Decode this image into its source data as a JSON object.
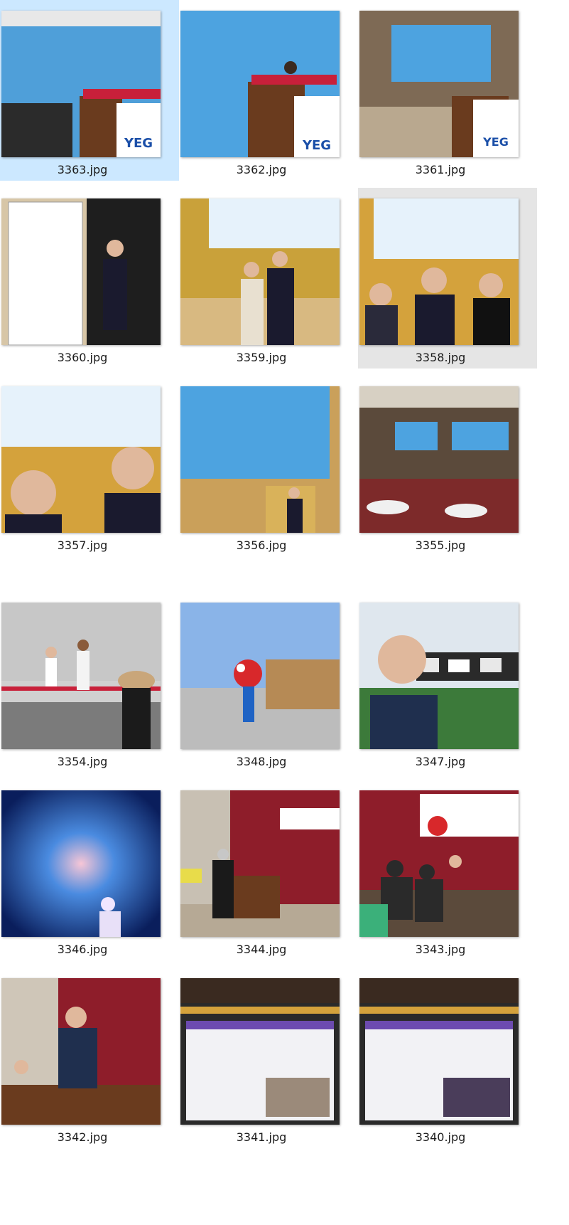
{
  "files": [
    {
      "name": "3363.jpg",
      "state": "selected",
      "scene": "ceremony-yeg"
    },
    {
      "name": "3362.jpg",
      "state": "normal",
      "scene": "speech-governor"
    },
    {
      "name": "3361.jpg",
      "state": "normal",
      "scene": "stage-wide"
    },
    {
      "name": "3360.jpg",
      "state": "normal",
      "scene": "signboard"
    },
    {
      "name": "3359.jpg",
      "state": "normal",
      "scene": "party-pair"
    },
    {
      "name": "3358.jpg",
      "state": "hover",
      "scene": "party-trio"
    },
    {
      "name": "3357.jpg",
      "state": "normal",
      "scene": "selfie-two"
    },
    {
      "name": "3356.jpg",
      "state": "normal",
      "scene": "screen-speaker"
    },
    {
      "name": "3355.jpg",
      "state": "normal",
      "scene": "banquet-hall"
    },
    {
      "name": "3354.jpg",
      "state": "normal",
      "scene": "street-performance"
    },
    {
      "name": "3348.jpg",
      "state": "normal",
      "scene": "expo-mascot"
    },
    {
      "name": "3347.jpg",
      "state": "normal",
      "scene": "expo-selfie"
    },
    {
      "name": "3346.jpg",
      "state": "normal",
      "scene": "galaxy-show"
    },
    {
      "name": "3344.jpg",
      "state": "normal",
      "scene": "assembly-podium"
    },
    {
      "name": "3343.jpg",
      "state": "normal",
      "scene": "assembly-audience"
    },
    {
      "name": "3342.jpg",
      "state": "normal",
      "scene": "assembly-speaker"
    },
    {
      "name": "3341.jpg",
      "state": "normal",
      "scene": "lecture-slide"
    },
    {
      "name": "3340.jpg",
      "state": "normal",
      "scene": "lecture-slide-2"
    }
  ],
  "colors": {
    "selected_bg": "#cce8ff",
    "hover_bg": "#e5e5e5"
  }
}
